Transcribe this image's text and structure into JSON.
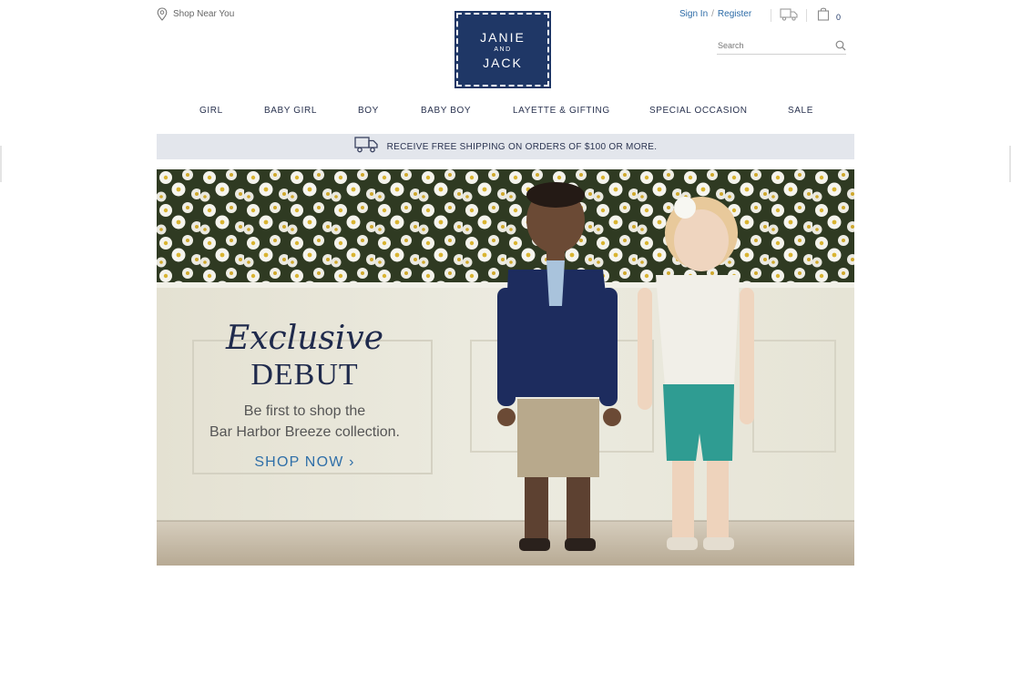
{
  "header": {
    "shop_near": "Shop Near You",
    "logo": {
      "line1": "JANIE",
      "line2": "AND",
      "line3": "JACK"
    },
    "sign_in": "Sign In",
    "separator": "/",
    "register": "Register",
    "bag_count": "0",
    "search_placeholder": "Search"
  },
  "nav": [
    "GIRL",
    "BABY GIRL",
    "BOY",
    "BABY BOY",
    "LAYETTE & GIFTING",
    "SPECIAL OCCASION",
    "SALE"
  ],
  "promo": {
    "text": "RECEIVE FREE SHIPPING ON ORDERS OF $100 OR MORE."
  },
  "hero": {
    "script_title": "Exclusive",
    "title": "DEBUT",
    "sub_line1": "Be first to shop the",
    "sub_line2": "Bar Harbor Breeze collection.",
    "cta": "SHOP NOW ›"
  },
  "colors": {
    "brand_navy": "#1f3766",
    "link_blue": "#2f6fa8",
    "promo_bg": "#e3e6ec"
  },
  "icons": [
    "map-pin-icon",
    "truck-icon",
    "shopping-bag-icon",
    "search-icon"
  ]
}
